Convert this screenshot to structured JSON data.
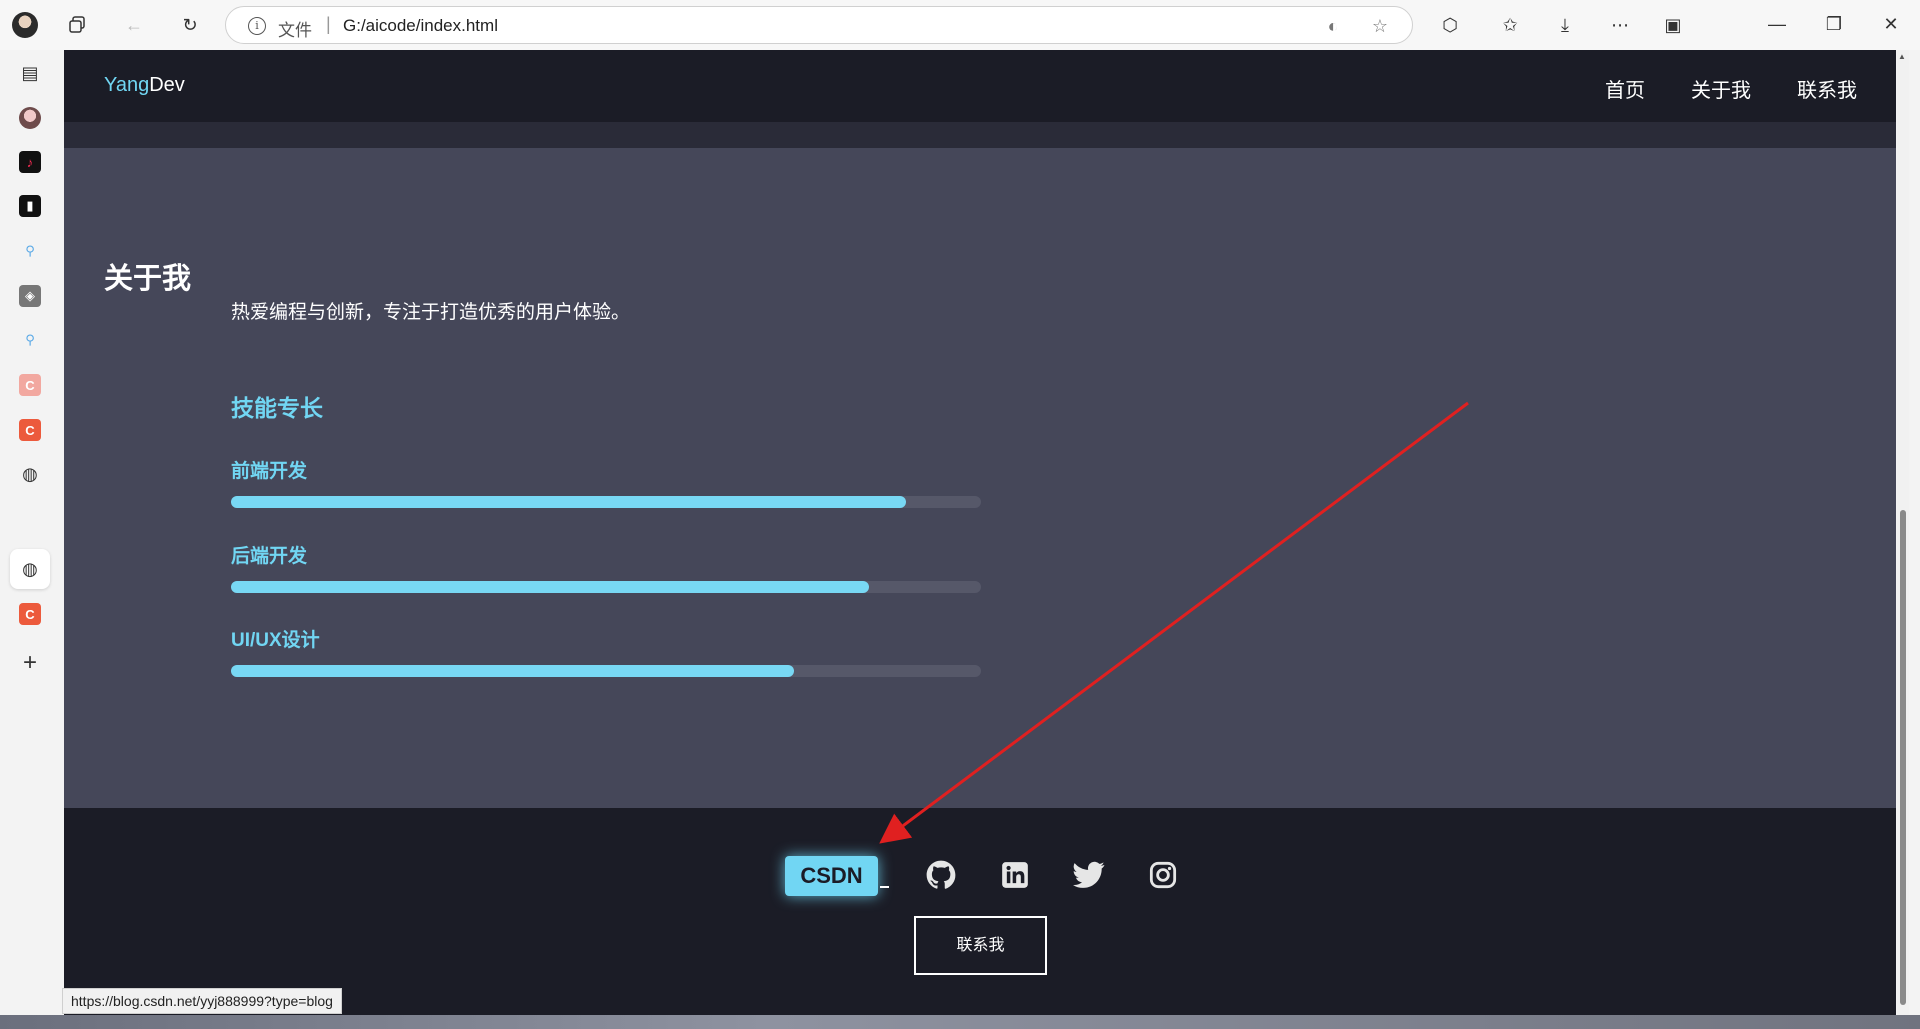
{
  "browser": {
    "address_scheme": "文件",
    "address_sep": "|",
    "address_url": "G:/aicode/index.html",
    "status_url": "https://blog.csdn.net/yyj888999?type=blog"
  },
  "sidebar": {
    "items": [
      {
        "name": "tabs-icon"
      },
      {
        "name": "profile-icon"
      },
      {
        "name": "tiktok-icon"
      },
      {
        "name": "app-icon"
      },
      {
        "name": "search-icon"
      },
      {
        "name": "cube-icon"
      },
      {
        "name": "search-icon"
      },
      {
        "name": "csdn-icon",
        "label": "C"
      },
      {
        "name": "csdn-icon",
        "label": "C"
      },
      {
        "name": "globe-icon"
      },
      {
        "name": "globe-icon"
      },
      {
        "name": "csdn-icon",
        "label": "C"
      },
      {
        "name": "add-icon",
        "label": "+"
      }
    ]
  },
  "site": {
    "logo_accent": "Yang",
    "logo_rest": "Dev",
    "nav": [
      "首页",
      "关于我",
      "联系我"
    ],
    "about": {
      "title": "关于我",
      "description": "热爱编程与创新，专注于打造优秀的用户体验。",
      "skills_title": "技能专长",
      "skills": [
        {
          "name": "前端开发",
          "level": 0.9
        },
        {
          "name": "后端开发",
          "level": 0.85
        },
        {
          "name": "UI/UX设计",
          "level": 0.75
        }
      ]
    },
    "footer": {
      "csdn_label": "CSDN",
      "social_icons": [
        "github-icon",
        "linkedin-icon",
        "twitter-icon",
        "instagram-icon"
      ],
      "contact_label": "联系我"
    }
  },
  "colors": {
    "accent": "#71d6f3",
    "nav_bg": "#1b1c26",
    "section_bg": "#454759",
    "annotation_arrow": "#e02020"
  }
}
